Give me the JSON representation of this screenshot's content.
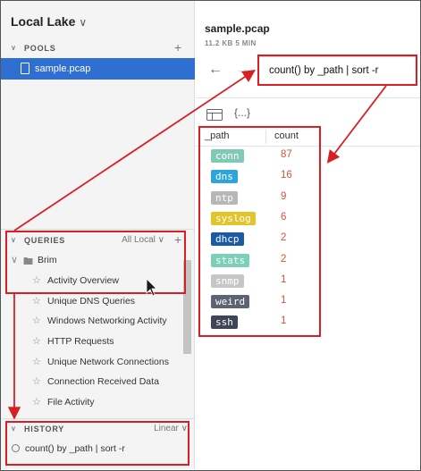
{
  "sidebar": {
    "lake_title": "Local Lake",
    "pools": {
      "label": "POOLS",
      "items": [
        {
          "name": "sample.pcap",
          "selected": true
        }
      ]
    },
    "queries": {
      "label": "QUERIES",
      "filter": "All Local",
      "group": "Brim",
      "items": [
        "Activity Overview",
        "Unique DNS Queries",
        "Windows Networking Activity",
        "HTTP Requests",
        "Unique Network Connections",
        "Connection Received Data",
        "File Activity"
      ]
    },
    "history": {
      "label": "HISTORY",
      "mode": "Linear",
      "items": [
        "count() by _path | sort -r"
      ]
    }
  },
  "main": {
    "file_title": "sample.pcap",
    "file_meta": "11.2 KB   5 MIN",
    "query": "count() by _path | sort -r",
    "view_json_label": "{...}",
    "columns": [
      "_path",
      "count"
    ],
    "rows": [
      {
        "path": "conn",
        "count": "87",
        "color": "#7fc9b5"
      },
      {
        "path": "dns",
        "count": "16",
        "color": "#2fa3db"
      },
      {
        "path": "ntp",
        "count": "9",
        "color": "#b7b7b7"
      },
      {
        "path": "syslog",
        "count": "6",
        "color": "#e1c52b"
      },
      {
        "path": "dhcp",
        "count": "2",
        "color": "#1d5aa6"
      },
      {
        "path": "stats",
        "count": "2",
        "color": "#7cd0b8"
      },
      {
        "path": "snmp",
        "count": "1",
        "color": "#c6c6c6"
      },
      {
        "path": "weird",
        "count": "1",
        "color": "#5c6472"
      },
      {
        "path": "ssh",
        "count": "1",
        "color": "#3d4556"
      }
    ]
  },
  "icons": {
    "lake_chevron": "chevron-down-icon",
    "collapse_caret": "caret-down-icon",
    "add": "plus-icon",
    "file": "file-icon",
    "folder": "folder-icon",
    "star": "star-icon",
    "search": "search-icon",
    "back": "arrow-left-icon",
    "forward": "arrow-right-icon",
    "table_view": "table-icon",
    "json_view": "json-icon"
  },
  "colors": {
    "selection": "#2f6fd1",
    "count_text": "#d1543a",
    "annotation": "#d91f26"
  }
}
